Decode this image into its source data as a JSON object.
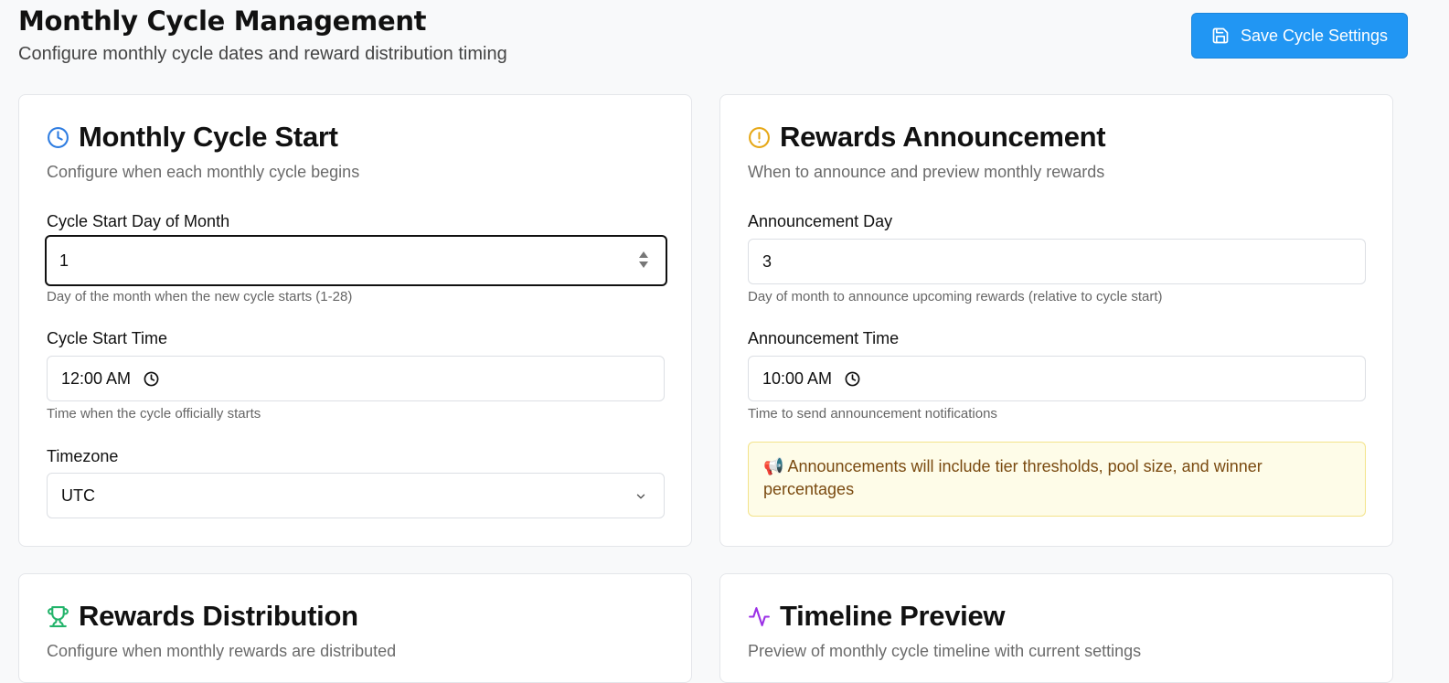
{
  "header": {
    "title": "Monthly Cycle Management",
    "subtitle": "Configure monthly cycle dates and reward distribution timing",
    "save_label": "Save Cycle Settings"
  },
  "colors": {
    "primary": "#2196f3",
    "clock_icon": "#2f7de1",
    "alert_icon": "#e6a817",
    "trophy_icon": "#22b36a",
    "activity_icon": "#9b30e6"
  },
  "cycle_start": {
    "title": "Monthly Cycle Start",
    "subtitle": "Configure when each monthly cycle begins",
    "icon": "clock-icon",
    "day_label": "Cycle Start Day of Month",
    "day_value": "1",
    "day_help": "Day of the month when the new cycle starts (1-28)",
    "time_label": "Cycle Start Time",
    "time_value": "12:00 AM",
    "time_help": "Time when the cycle officially starts",
    "tz_label": "Timezone",
    "tz_value": "UTC"
  },
  "announcement": {
    "title": "Rewards Announcement",
    "subtitle": "When to announce and preview monthly rewards",
    "icon": "alert-circle-icon",
    "day_label": "Announcement Day",
    "day_value": "3",
    "day_help": "Day of month to announce upcoming rewards (relative to cycle start)",
    "time_label": "Announcement Time",
    "time_value": "10:00 AM",
    "time_help": "Time to send announcement notifications",
    "note_emoji": "📢",
    "note": "Announcements will include tier thresholds, pool size, and winner percentages"
  },
  "distribution": {
    "title": "Rewards Distribution",
    "subtitle": "Configure when monthly rewards are distributed",
    "icon": "trophy-icon"
  },
  "timeline": {
    "title": "Timeline Preview",
    "subtitle": "Preview of monthly cycle timeline with current settings",
    "icon": "activity-icon"
  }
}
